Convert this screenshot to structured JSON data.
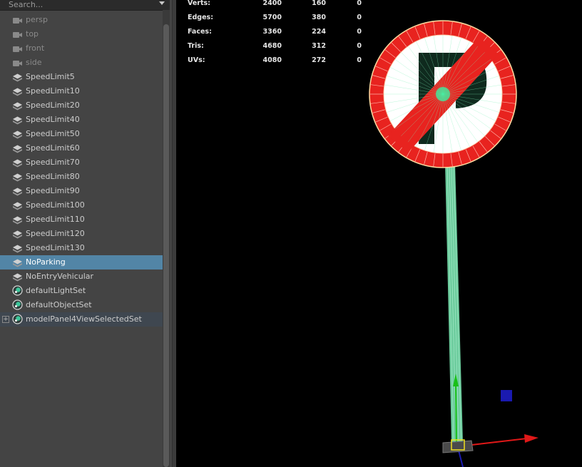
{
  "outliner": {
    "search": {
      "placeholder": "Search...",
      "value": ""
    },
    "items": [
      {
        "label": "persp",
        "type": "camera"
      },
      {
        "label": "top",
        "type": "camera"
      },
      {
        "label": "front",
        "type": "camera"
      },
      {
        "label": "side",
        "type": "camera"
      },
      {
        "label": "SpeedLimit5",
        "type": "mesh"
      },
      {
        "label": "SpeedLimit10",
        "type": "mesh"
      },
      {
        "label": "SpeedLimit20",
        "type": "mesh"
      },
      {
        "label": "SpeedLimit40",
        "type": "mesh"
      },
      {
        "label": "SpeedLimit50",
        "type": "mesh"
      },
      {
        "label": "SpeedLimit60",
        "type": "mesh"
      },
      {
        "label": "SpeedLimit70",
        "type": "mesh"
      },
      {
        "label": "SpeedLimit80",
        "type": "mesh"
      },
      {
        "label": "SpeedLimit90",
        "type": "mesh"
      },
      {
        "label": "SpeedLimit100",
        "type": "mesh"
      },
      {
        "label": "SpeedLimit110",
        "type": "mesh"
      },
      {
        "label": "SpeedLimit120",
        "type": "mesh"
      },
      {
        "label": "SpeedLimit130",
        "type": "mesh"
      },
      {
        "label": "NoParking",
        "type": "mesh",
        "selected": true
      },
      {
        "label": "NoEntryVehicular",
        "type": "mesh"
      },
      {
        "label": "defaultLightSet",
        "type": "set"
      },
      {
        "label": "defaultObjectSet",
        "type": "set"
      },
      {
        "label": "modelPanel4ViewSelectedSet",
        "type": "set",
        "expandable": true,
        "highlighted": true
      }
    ]
  },
  "viewport": {
    "hud": [
      {
        "label": "Verts:",
        "values": [
          "2400",
          "160",
          "0"
        ]
      },
      {
        "label": "Edges:",
        "values": [
          "5700",
          "380",
          "0"
        ]
      },
      {
        "label": "Faces:",
        "values": [
          "3360",
          "224",
          "0"
        ]
      },
      {
        "label": "Tris:",
        "values": [
          "4680",
          "312",
          "0"
        ]
      },
      {
        "label": "UVs:",
        "values": [
          "4080",
          "272",
          "0"
        ]
      }
    ],
    "colors": {
      "background": "#000000",
      "sign_ring": "#e8231f",
      "sign_face": "#ffffff",
      "letter": "#0f2a1e",
      "selection": "#7ff0b8",
      "axis_x": "#e01818",
      "axis_y": "#18c018",
      "axis_z": "#1a1ab0",
      "manip_center": "#f0e020"
    },
    "sign_letter": "P"
  }
}
